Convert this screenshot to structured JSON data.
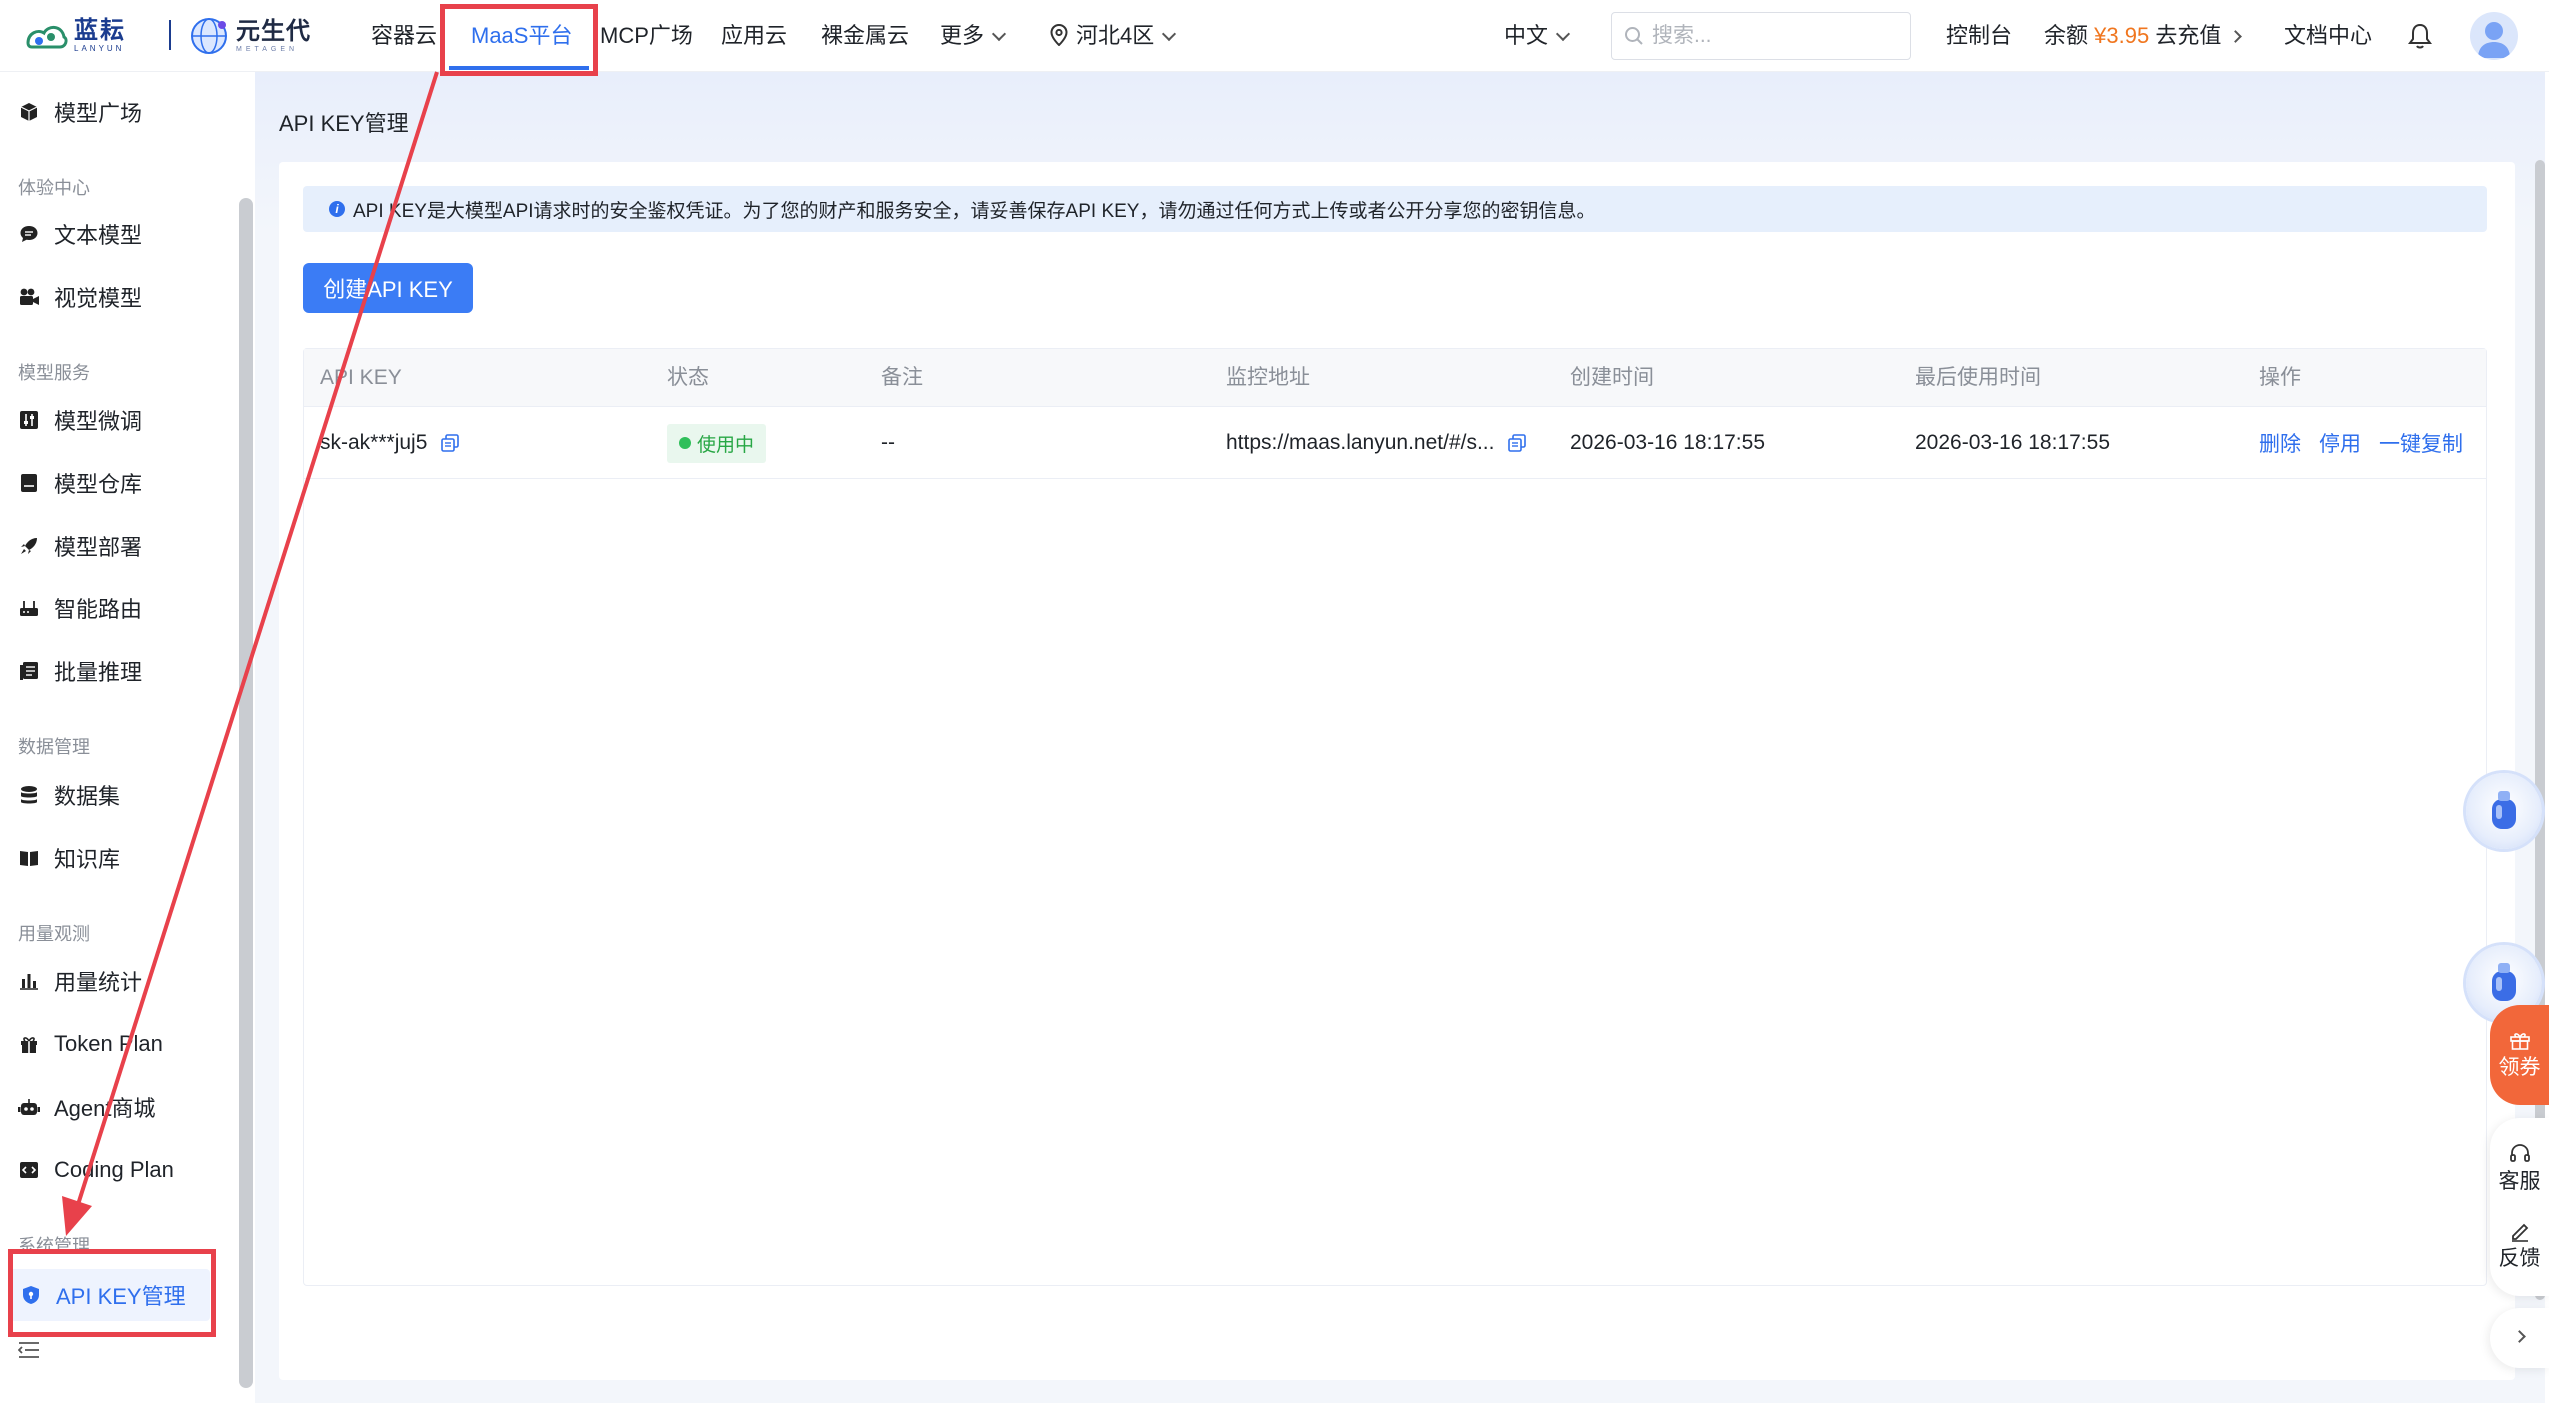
{
  "header": {
    "logo_primary": "蓝耘",
    "logo_primary_sub": "LANYUN",
    "logo_secondary": "元生代",
    "logo_secondary_sub": "METAGEN",
    "nav": [
      {
        "label": "容器云"
      },
      {
        "label": "MaaS平台",
        "active": true
      },
      {
        "label": "MCP广场"
      },
      {
        "label": "应用云"
      },
      {
        "label": "裸金属云"
      },
      {
        "label": "更多"
      }
    ],
    "region": "河北4区",
    "language": "中文",
    "search_placeholder": "搜索...",
    "console": "控制台",
    "balance_label": "余额",
    "balance_amount": "¥3.95",
    "recharge": "去充值",
    "docs": "文档中心",
    "accent_color": "#2f6fed"
  },
  "sidebar": {
    "items": [
      {
        "label": "模型广场",
        "icon": "cube-icon"
      },
      {
        "group": "体验中心"
      },
      {
        "label": "文本模型",
        "icon": "chat-icon"
      },
      {
        "label": "视觉模型",
        "icon": "camera-icon"
      },
      {
        "group": "模型服务"
      },
      {
        "label": "模型微调",
        "icon": "sliders-icon"
      },
      {
        "label": "模型仓库",
        "icon": "box-icon"
      },
      {
        "label": "模型部署",
        "icon": "rocket-icon"
      },
      {
        "label": "智能路由",
        "icon": "router-icon"
      },
      {
        "label": "批量推理",
        "icon": "list-icon"
      },
      {
        "group": "数据管理"
      },
      {
        "label": "数据集",
        "icon": "database-icon"
      },
      {
        "label": "知识库",
        "icon": "book-icon"
      },
      {
        "group": "用量观测"
      },
      {
        "label": "用量统计",
        "icon": "bar-chart-icon"
      },
      {
        "label": "Token Plan",
        "icon": "gift-icon"
      },
      {
        "label": "Agent商城",
        "icon": "robot-icon"
      },
      {
        "label": "Coding Plan",
        "icon": "code-icon"
      },
      {
        "group": "系统管理"
      },
      {
        "label": "API KEY管理",
        "icon": "shield-icon",
        "active": true
      }
    ]
  },
  "main": {
    "page_title": "API KEY管理",
    "notice": "API KEY是大模型API请求时的安全鉴权凭证。为了您的财产和服务安全，请妥善保存API KEY，请勿通过任何方式上传或者公开分享您的密钥信息。",
    "create_button": "创建API KEY",
    "table": {
      "columns": [
        "API KEY",
        "状态",
        "备注",
        "监控地址",
        "创建时间",
        "最后使用时间",
        "操作"
      ],
      "rows": [
        {
          "api_key": "sk-ak***juj5",
          "status": "使用中",
          "remark": "--",
          "monitor_url": "https://maas.lanyun.net/#/s...",
          "created_at": "2026-03-16 18:17:55",
          "last_used_at": "2026-03-16 18:17:55",
          "actions": [
            "删除",
            "停用",
            "一键复制"
          ]
        }
      ]
    }
  },
  "floating": {
    "coupon": "领券",
    "service": "客服",
    "feedback": "反馈"
  }
}
